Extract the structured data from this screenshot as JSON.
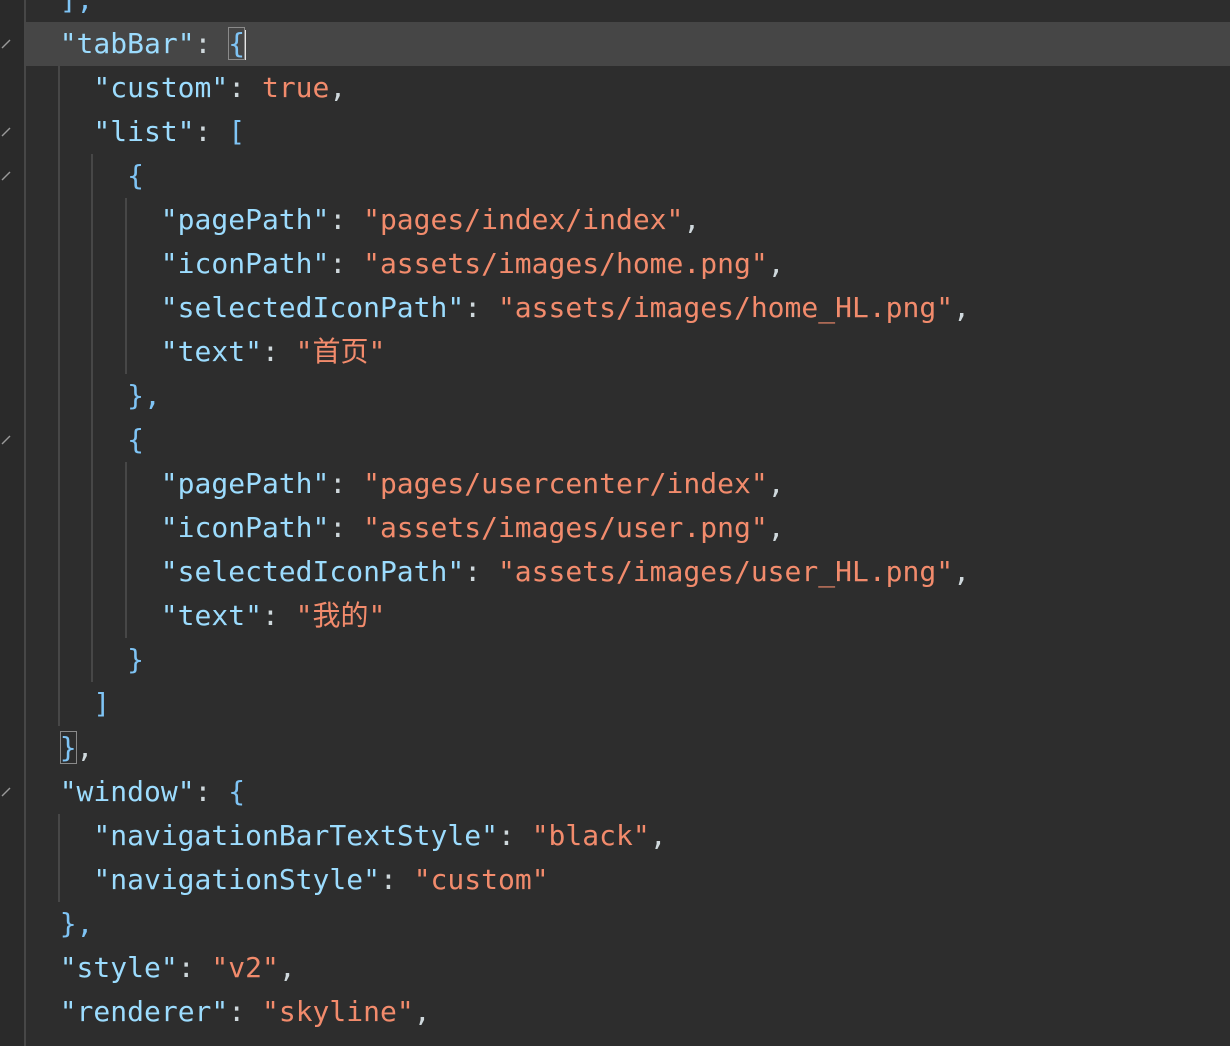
{
  "colors": {
    "background": "#2d2d2d",
    "current_line": "#464646",
    "key": "#9cdcfe",
    "string": "#f28b6c",
    "literal": "#f28b6c",
    "punctuation": "#cfd8dc",
    "bracket": "#7fc4f5",
    "indent_guide": "#474747"
  },
  "editor": {
    "lines": [
      {
        "indent": 1,
        "tokens": [
          {
            "t": "],",
            "k": "bracket"
          }
        ]
      },
      {
        "indent": 1,
        "fold": true,
        "current": true,
        "tokens": [
          {
            "t": "\"tabBar\"",
            "k": "key"
          },
          {
            "t": ": ",
            "k": "punct"
          },
          {
            "t": "{",
            "k": "bracket",
            "match": true
          }
        ]
      },
      {
        "indent": 2,
        "tokens": [
          {
            "t": "\"custom\"",
            "k": "key"
          },
          {
            "t": ": ",
            "k": "punct"
          },
          {
            "t": "true",
            "k": "literal"
          },
          {
            "t": ",",
            "k": "punct"
          }
        ]
      },
      {
        "indent": 2,
        "fold": true,
        "tokens": [
          {
            "t": "\"list\"",
            "k": "key"
          },
          {
            "t": ": ",
            "k": "punct"
          },
          {
            "t": "[",
            "k": "bracket"
          }
        ]
      },
      {
        "indent": 3,
        "fold": true,
        "tokens": [
          {
            "t": "{",
            "k": "bracket"
          }
        ]
      },
      {
        "indent": 4,
        "tokens": [
          {
            "t": "\"pagePath\"",
            "k": "key"
          },
          {
            "t": ": ",
            "k": "punct"
          },
          {
            "t": "\"pages/index/index\"",
            "k": "string"
          },
          {
            "t": ",",
            "k": "punct"
          }
        ]
      },
      {
        "indent": 4,
        "tokens": [
          {
            "t": "\"iconPath\"",
            "k": "key"
          },
          {
            "t": ": ",
            "k": "punct"
          },
          {
            "t": "\"assets/images/home.png\"",
            "k": "string"
          },
          {
            "t": ",",
            "k": "punct"
          }
        ]
      },
      {
        "indent": 4,
        "tokens": [
          {
            "t": "\"selectedIconPath\"",
            "k": "key"
          },
          {
            "t": ": ",
            "k": "punct"
          },
          {
            "t": "\"assets/images/home_HL.png\"",
            "k": "string"
          },
          {
            "t": ",",
            "k": "punct"
          }
        ]
      },
      {
        "indent": 4,
        "tokens": [
          {
            "t": "\"text\"",
            "k": "key"
          },
          {
            "t": ": ",
            "k": "punct"
          },
          {
            "t": "\"首页\"",
            "k": "string"
          }
        ]
      },
      {
        "indent": 3,
        "tokens": [
          {
            "t": "},",
            "k": "bracket"
          }
        ]
      },
      {
        "indent": 3,
        "fold": true,
        "tokens": [
          {
            "t": "{",
            "k": "bracket"
          }
        ]
      },
      {
        "indent": 4,
        "tokens": [
          {
            "t": "\"pagePath\"",
            "k": "key"
          },
          {
            "t": ": ",
            "k": "punct"
          },
          {
            "t": "\"pages/usercenter/index\"",
            "k": "string"
          },
          {
            "t": ",",
            "k": "punct"
          }
        ]
      },
      {
        "indent": 4,
        "tokens": [
          {
            "t": "\"iconPath\"",
            "k": "key"
          },
          {
            "t": ": ",
            "k": "punct"
          },
          {
            "t": "\"assets/images/user.png\"",
            "k": "string"
          },
          {
            "t": ",",
            "k": "punct"
          }
        ]
      },
      {
        "indent": 4,
        "tokens": [
          {
            "t": "\"selectedIconPath\"",
            "k": "key"
          },
          {
            "t": ": ",
            "k": "punct"
          },
          {
            "t": "\"assets/images/user_HL.png\"",
            "k": "string"
          },
          {
            "t": ",",
            "k": "punct"
          }
        ]
      },
      {
        "indent": 4,
        "tokens": [
          {
            "t": "\"text\"",
            "k": "key"
          },
          {
            "t": ": ",
            "k": "punct"
          },
          {
            "t": "\"我的\"",
            "k": "string"
          }
        ]
      },
      {
        "indent": 3,
        "tokens": [
          {
            "t": "}",
            "k": "bracket"
          }
        ]
      },
      {
        "indent": 2,
        "tokens": [
          {
            "t": "]",
            "k": "bracket"
          }
        ]
      },
      {
        "indent": 1,
        "tokens": [
          {
            "t": "}",
            "k": "bracket",
            "match": true
          },
          {
            "t": ",",
            "k": "punct"
          }
        ]
      },
      {
        "indent": 1,
        "fold": true,
        "tokens": [
          {
            "t": "\"window\"",
            "k": "key"
          },
          {
            "t": ": ",
            "k": "punct"
          },
          {
            "t": "{",
            "k": "bracket"
          }
        ]
      },
      {
        "indent": 2,
        "tokens": [
          {
            "t": "\"navigationBarTextStyle\"",
            "k": "key"
          },
          {
            "t": ": ",
            "k": "punct"
          },
          {
            "t": "\"black\"",
            "k": "string"
          },
          {
            "t": ",",
            "k": "punct"
          }
        ]
      },
      {
        "indent": 2,
        "tokens": [
          {
            "t": "\"navigationStyle\"",
            "k": "key"
          },
          {
            "t": ": ",
            "k": "punct"
          },
          {
            "t": "\"custom\"",
            "k": "string"
          }
        ]
      },
      {
        "indent": 1,
        "tokens": [
          {
            "t": "},",
            "k": "bracket"
          }
        ]
      },
      {
        "indent": 1,
        "tokens": [
          {
            "t": "\"style\"",
            "k": "key"
          },
          {
            "t": ": ",
            "k": "punct"
          },
          {
            "t": "\"v2\"",
            "k": "string"
          },
          {
            "t": ",",
            "k": "punct"
          }
        ]
      },
      {
        "indent": 1,
        "tokens": [
          {
            "t": "\"renderer\"",
            "k": "key"
          },
          {
            "t": ": ",
            "k": "punct"
          },
          {
            "t": "\"skyline\"",
            "k": "string"
          },
          {
            "t": ",",
            "k": "punct"
          }
        ]
      },
      {
        "indent": 1,
        "tokens": [
          {
            "t": "",
            "k": "punct"
          }
        ]
      }
    ]
  }
}
